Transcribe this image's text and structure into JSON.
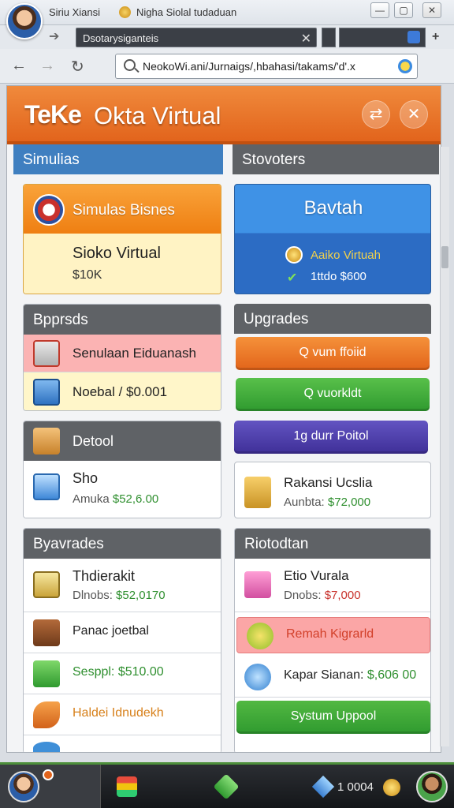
{
  "window": {
    "title_left": "Siriu Xiansi",
    "title_right": "Nigha Siolal tudaduan",
    "minimize": "—",
    "maximize": "▢",
    "close": "✕"
  },
  "tabs": {
    "active_label": "Dsotarysiganteis",
    "close_label": "✕",
    "add_label": "+"
  },
  "address": {
    "back": "←",
    "forward": "→",
    "reload": "↻",
    "url": "NeokoWi.ani/Jurnaigs/,hbahasi/takams/'d'.x"
  },
  "header": {
    "logo": "TeKe",
    "title": "Okta Virtual",
    "btn_shuffle": "⇄",
    "btn_close": "✕"
  },
  "left": {
    "sim_header": "Simulias",
    "sim_banner": "Simulas Bisnes",
    "sim_name": "Sioko Virtual",
    "sim_amount": "$10K",
    "bpprds_header": "Bpprsds",
    "bpprds_items": [
      "Senulaan Eiduanash",
      "Noebal / $0.001"
    ],
    "detool_label": "Detool",
    "sho": {
      "title": "Sho",
      "label": "Amuka",
      "value": "$52,6.00"
    },
    "byavrades_header": "Byavrades",
    "rows": [
      {
        "title": "Thdierakit",
        "label": "Dlnobs:",
        "value": "$52,0170"
      },
      {
        "title": "Panac joetbal",
        "label": "",
        "value": ""
      },
      {
        "title": "Sesppl: $510.00",
        "label": "",
        "value": ""
      },
      {
        "title": "Haldei Idnudekh",
        "label": "",
        "value": ""
      }
    ]
  },
  "right": {
    "stovoters_header": "Stovoters",
    "bavtah_title": "Bavtah",
    "bavtah_line1": "Aaiko Virtuah",
    "bavtah_line2": "1ttdo $600",
    "upgrades_header": "Upgrades",
    "buttons": [
      "Q vum ffoiid",
      "Q vuorkldt",
      "1g durr Poitol"
    ],
    "rakansi": {
      "title": "Rakansi Ucslia",
      "label": "Aunbta:",
      "value": "$72,000"
    },
    "riotodtan_header": "Riotodtan",
    "rows": [
      {
        "title": "Etio Vurala",
        "label": "Dnobs:",
        "value": "$7,000"
      },
      {
        "title": "Remah Kigrarld",
        "label": "",
        "value": ""
      },
      {
        "title": "Kapar Sianan:",
        "label": "",
        "value": "$,606 00"
      }
    ],
    "system_button": "Systum Uppool"
  },
  "taskbar": {
    "count": "1 0004"
  },
  "colors": {
    "header_orange": "#e2641c",
    "blue": "#3f7fc0",
    "green": "#3aa53a",
    "orange_btn": "#f07c1a",
    "purple_btn": "#4b3aa0"
  }
}
